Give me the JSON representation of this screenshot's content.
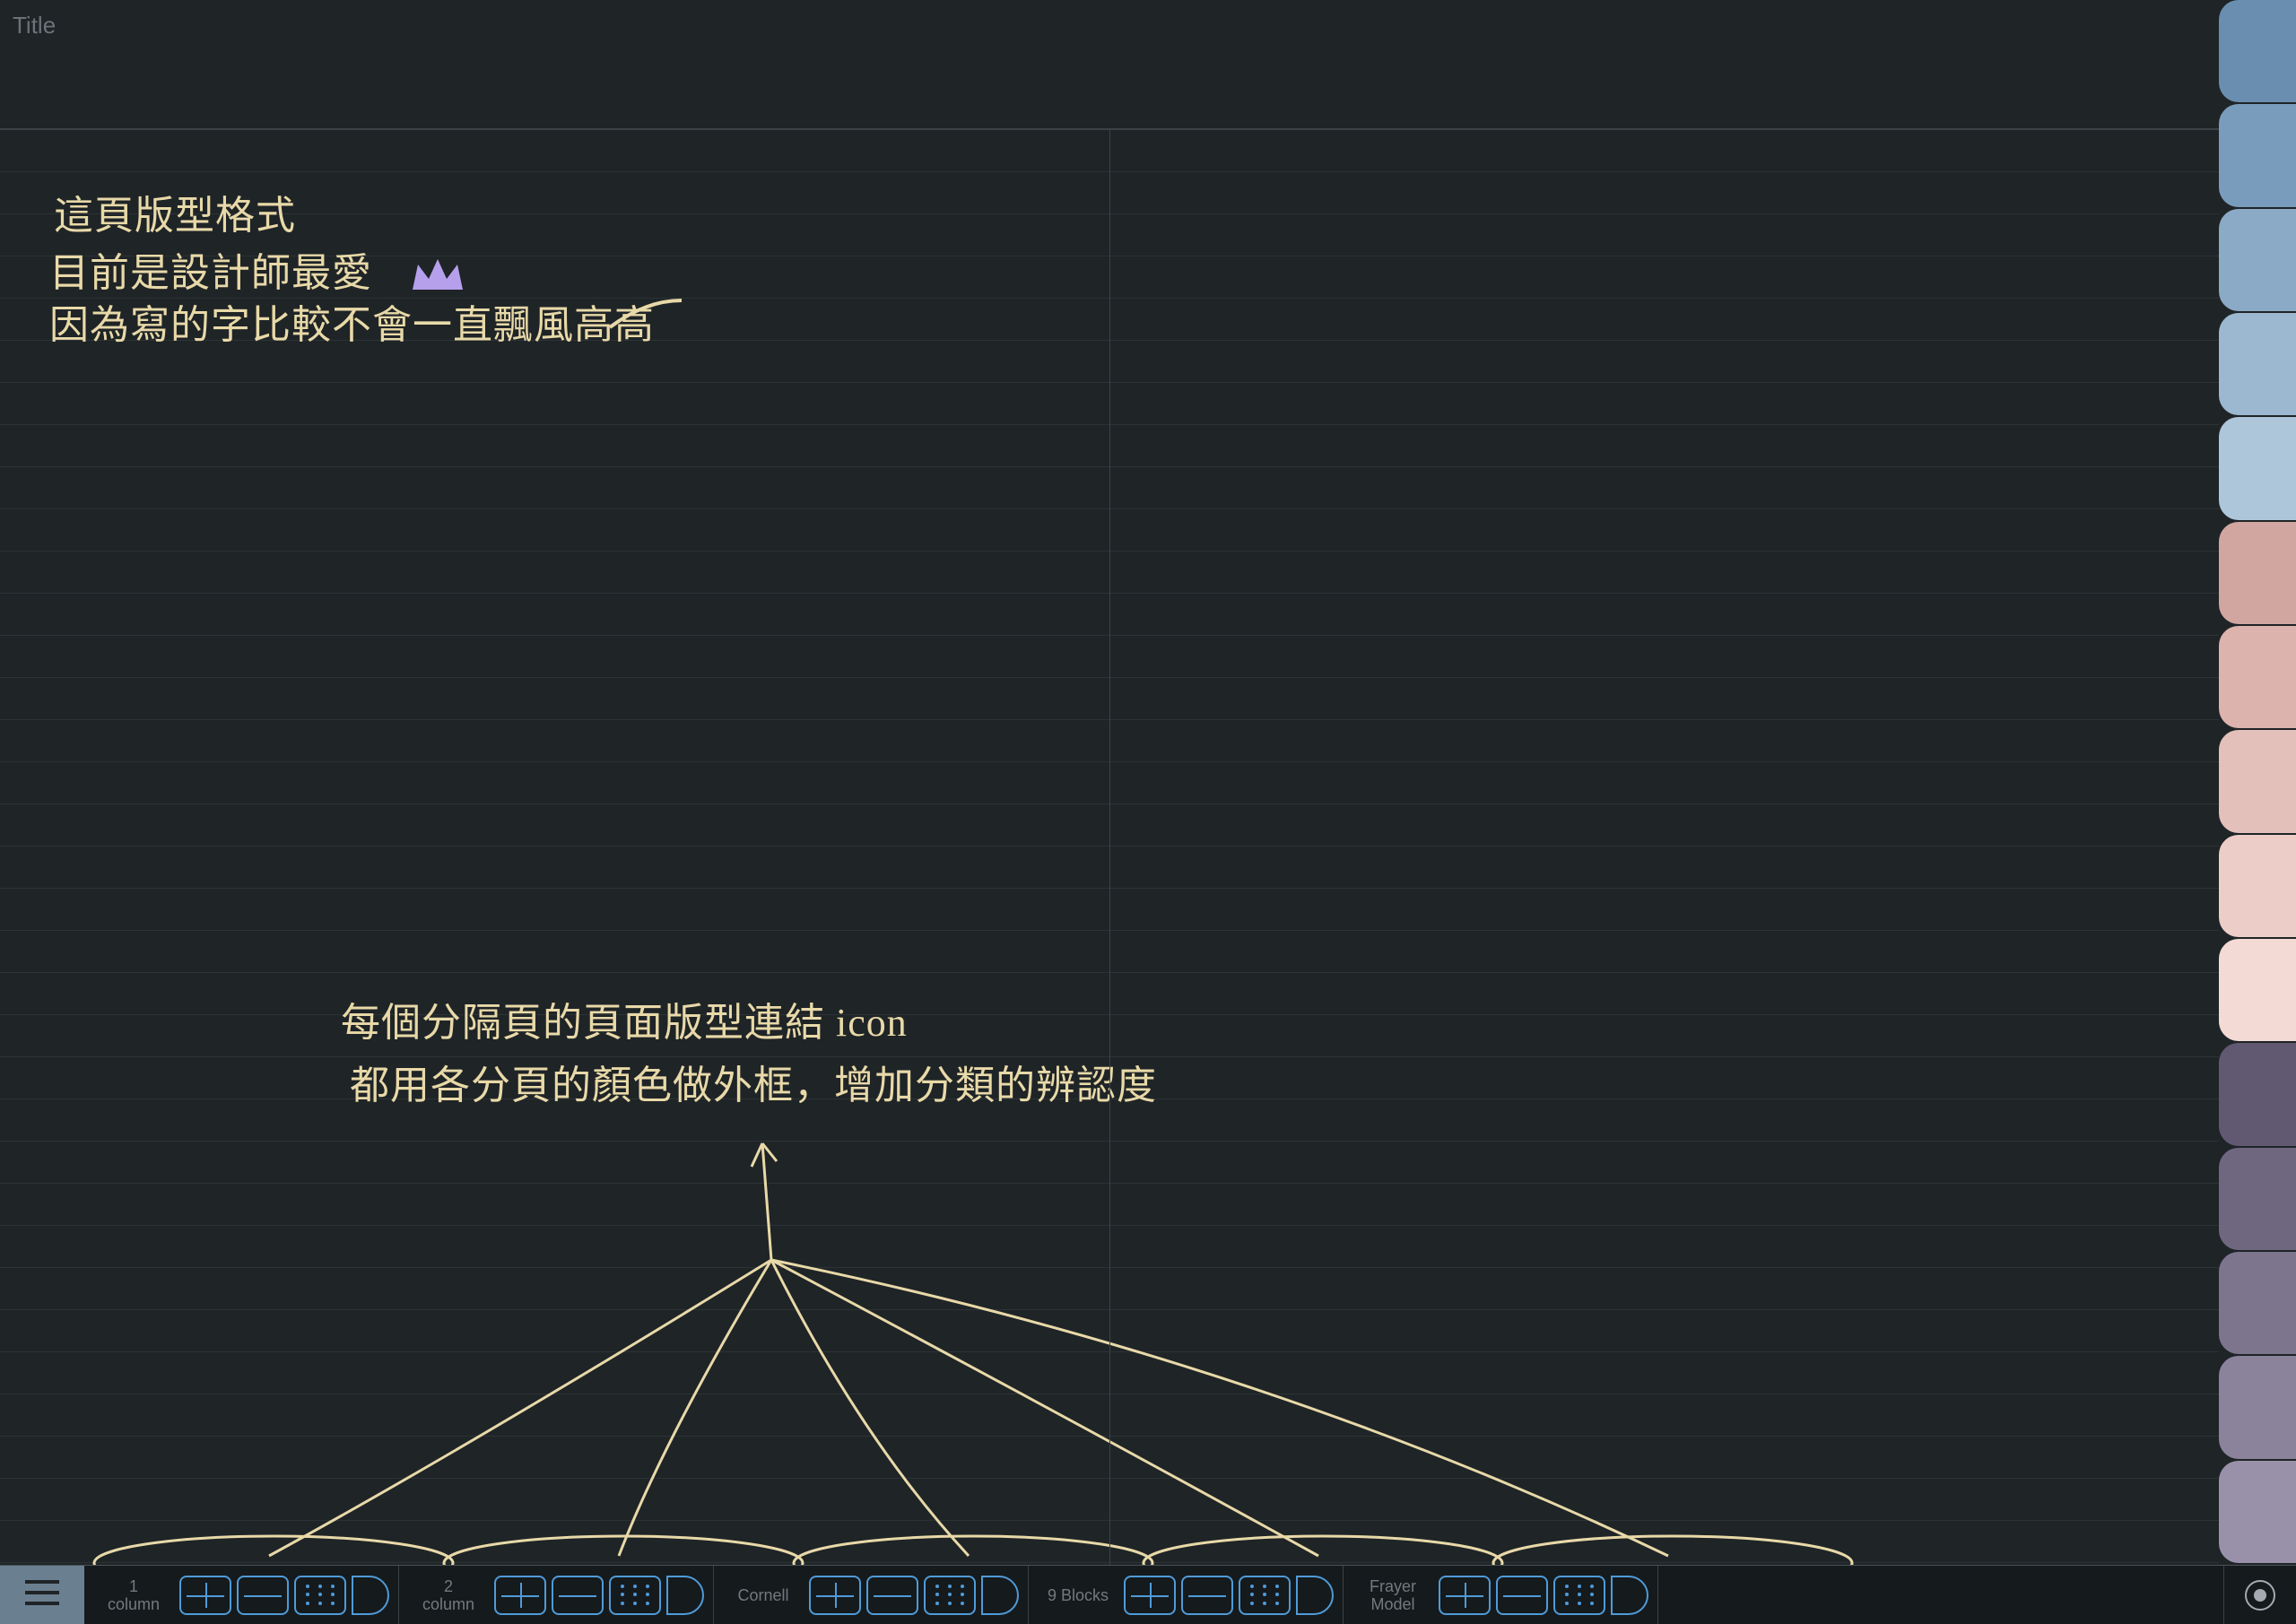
{
  "title_placeholder": "Title",
  "handwriting": {
    "line1": "這頁版型格式",
    "line2": "目前是設計師最愛",
    "line3": "因為寫的字比較不會一直飄風高高",
    "block2_line1": "每個分隔頁的頁面版型連結 icon",
    "block2_line2": "都用各分頁的顏色做外框，增加分類的辨認度"
  },
  "side_tabs": [
    {
      "color": "#6a8eb0"
    },
    {
      "color": "#7a9cbc"
    },
    {
      "color": "#8baac6"
    },
    {
      "color": "#9cb8d0"
    },
    {
      "color": "#aec6da"
    },
    {
      "color": "#d2a6a0"
    },
    {
      "color": "#dcb3ad"
    },
    {
      "color": "#e4c0ba"
    },
    {
      "color": "#eccdc7"
    },
    {
      "color": "#f3dad4"
    },
    {
      "color": "#615972"
    },
    {
      "color": "#6f6780"
    },
    {
      "color": "#7d758e"
    },
    {
      "color": "#8b839c"
    },
    {
      "color": "#9991aa"
    }
  ],
  "toolbar": {
    "groups": [
      {
        "label": "1\ncolumn"
      },
      {
        "label": "2\ncolumn"
      },
      {
        "label": "Cornell"
      },
      {
        "label": "9 Blocks"
      },
      {
        "label": "Frayer\nModel"
      }
    ],
    "icon_outline_color": "#4f9bd8"
  }
}
